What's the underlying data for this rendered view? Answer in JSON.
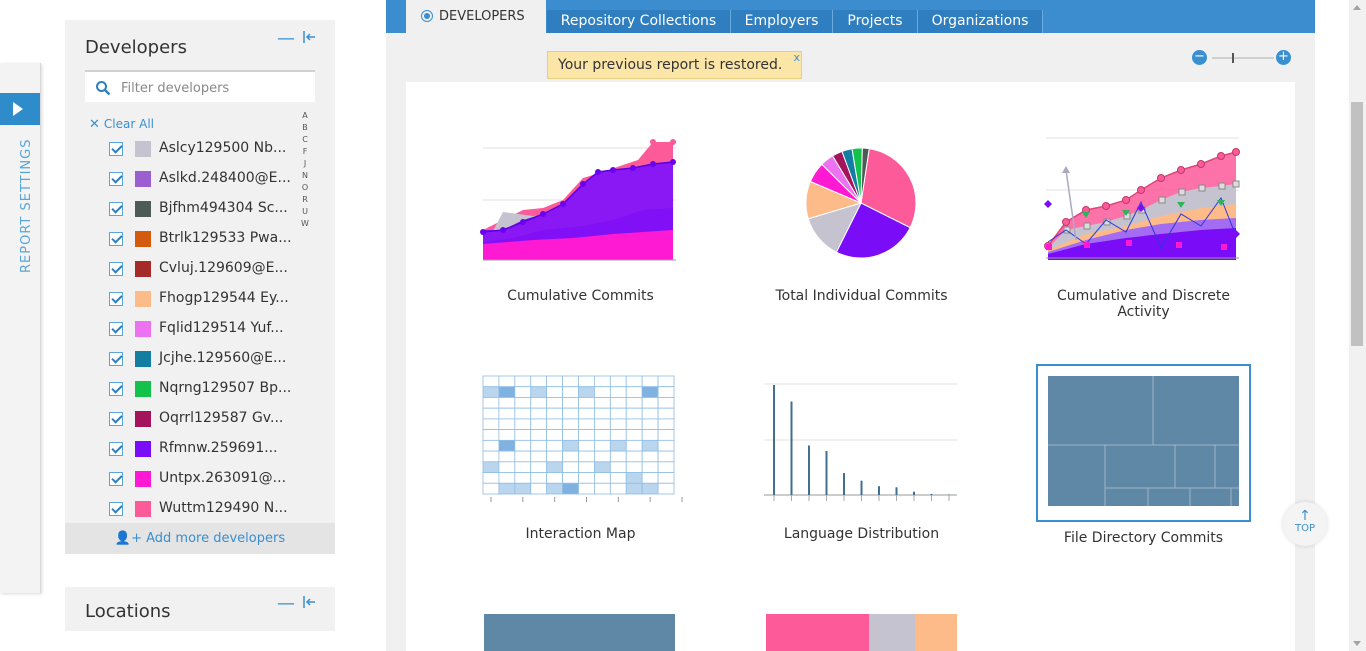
{
  "sidebar": {
    "report_settings_label": "REPORT SETTINGS",
    "accent_color": "#2f8ccb"
  },
  "developers_panel": {
    "title": "Developers",
    "filter_placeholder": "Filter developers",
    "clear_all": "Clear All",
    "alphabet": [
      "A",
      "B",
      "C",
      "F",
      "J",
      "N",
      "O",
      "R",
      "U",
      "W"
    ],
    "developers": [
      {
        "name": "Aslcy129500 Nb...",
        "color": "#c6c3d0",
        "checked": true
      },
      {
        "name": "Aslkd.248400@E...",
        "color": "#9b5fcf",
        "checked": true
      },
      {
        "name": "Bjfhm494304 Sc...",
        "color": "#4d5a55",
        "checked": true
      },
      {
        "name": "Btrlk129533 Pwa...",
        "color": "#d45a11",
        "checked": true
      },
      {
        "name": "Cvluj.129609@E...",
        "color": "#a52a2a",
        "checked": true
      },
      {
        "name": "Fhogp129544 Ey...",
        "color": "#fdbb8a",
        "checked": true
      },
      {
        "name": "Fqlid129514 Yuf...",
        "color": "#ec72f2",
        "checked": true
      },
      {
        "name": "Jcjhe.129560@E...",
        "color": "#137ea1",
        "checked": true
      },
      {
        "name": "Nqrng129507 Bp...",
        "color": "#12c24a",
        "checked": true
      },
      {
        "name": "Oqrrl129587 Gv...",
        "color": "#a3145c",
        "checked": true
      },
      {
        "name": "Rfmnw.259691...",
        "color": "#7b0cf7",
        "checked": true
      },
      {
        "name": "Untpx.263091@...",
        "color": "#fe19d2",
        "checked": true
      },
      {
        "name": "Wuttm129490 N...",
        "color": "#fd5a9a",
        "checked": true
      }
    ],
    "add_more": "Add more developers"
  },
  "locations_panel": {
    "title": "Locations"
  },
  "tabs": {
    "active": "DEVELOPERS",
    "items": [
      "Repository Collections",
      "Employers",
      "Projects",
      "Organizations"
    ]
  },
  "notice": {
    "text": "Your previous report is restored.",
    "close": "x"
  },
  "zoom": {
    "minus": "−",
    "plus": "+"
  },
  "charts": [
    {
      "caption": "Cumulative Commits"
    },
    {
      "caption": "Total Individual Commits"
    },
    {
      "caption": "Cumulative and Discrete Activity"
    },
    {
      "caption": "Interaction Map"
    },
    {
      "caption": "Language Distribution"
    },
    {
      "caption": "File Directory Commits",
      "selected": true
    }
  ],
  "pie_slices": [
    {
      "label": "Wuttm129490",
      "value": 30,
      "color": "#fd5a9a"
    },
    {
      "label": "Rfmnw.259691",
      "value": 25,
      "color": "#7b0cf7"
    },
    {
      "label": "Aslcy129500",
      "value": 13,
      "color": "#c6c3d0"
    },
    {
      "label": "Fhogp129544",
      "value": 11,
      "color": "#fdbb8a"
    },
    {
      "label": "Untpx.263091",
      "value": 6,
      "color": "#fe19d2"
    },
    {
      "label": "Fqlid129514",
      "value": 4,
      "color": "#ec72f2"
    },
    {
      "label": "Oqrrl129587",
      "value": 3,
      "color": "#a3145c"
    },
    {
      "label": "Jcjhe.129560",
      "value": 3,
      "color": "#137ea1"
    },
    {
      "label": "Nqrng129507",
      "value": 3,
      "color": "#12c24a"
    },
    {
      "label": "Bjfhm494304",
      "value": 2,
      "color": "#4d5a55"
    }
  ],
  "language_bars": [
    100,
    85,
    45,
    40,
    20,
    13,
    8,
    7,
    3,
    1,
    0.5
  ],
  "top_button": "TOP"
}
